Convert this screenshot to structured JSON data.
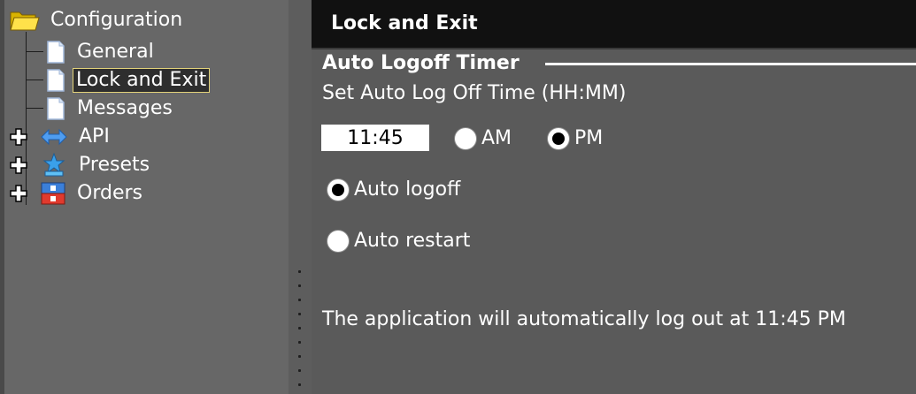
{
  "tree": {
    "root": {
      "label": "Configuration",
      "icon": "folder-icon"
    },
    "items": [
      {
        "label": "General",
        "icon": "document-icon",
        "selected": false
      },
      {
        "label": "Lock and Exit",
        "icon": "document-icon",
        "selected": true
      },
      {
        "label": "Messages",
        "icon": "document-icon",
        "selected": false
      },
      {
        "label": "API",
        "icon": "api-arrows-icon",
        "expandable": true
      },
      {
        "label": "Presets",
        "icon": "presets-icon",
        "expandable": true
      },
      {
        "label": "Orders",
        "icon": "orders-icon",
        "expandable": true
      }
    ]
  },
  "panel": {
    "title": "Lock and Exit",
    "group_title": "Auto Logoff Timer",
    "prompt": "Set Auto Log Off Time (HH:MM)",
    "time_value": "11:45",
    "meridiem": {
      "am_label": "AM",
      "pm_label": "PM",
      "selected": "PM"
    },
    "mode": {
      "auto_logoff_label": "Auto logoff",
      "auto_restart_label": "Auto restart",
      "selected": "Auto logoff"
    },
    "status_text": "The application will automatically log out at 11:45 PM"
  }
}
